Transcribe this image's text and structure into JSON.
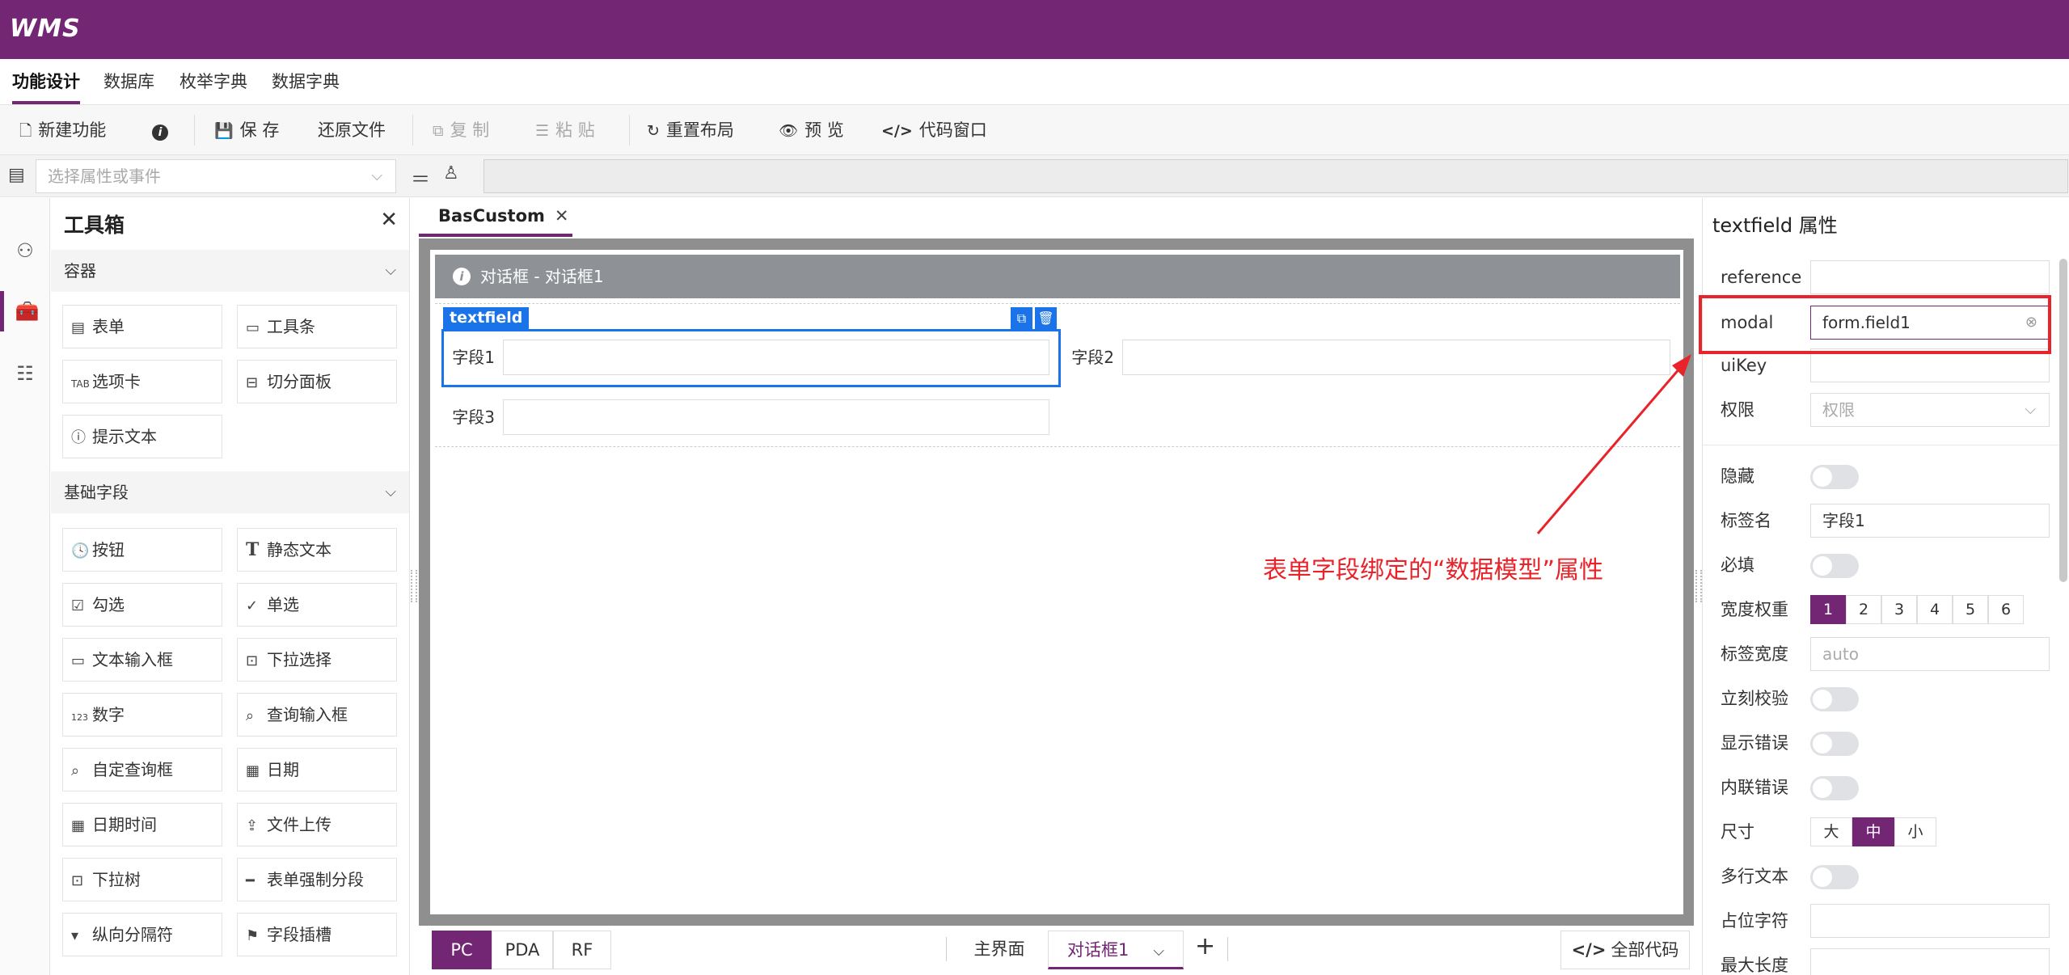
{
  "app": {
    "logo": "WMS"
  },
  "menu": {
    "items": [
      "功能设计",
      "数据库",
      "枚举字典",
      "数据字典"
    ]
  },
  "toolbar": {
    "new": "新建功能",
    "save": "保 存",
    "restore": "还原文件",
    "copy": "复 制",
    "paste": "粘 贴",
    "reset_layout": "重置布局",
    "preview": "预 览",
    "code_window": "代码窗口"
  },
  "selector": {
    "placeholder": "选择属性或事件"
  },
  "toolbox": {
    "title": "工具箱",
    "sections": [
      {
        "title": "容器",
        "items": [
          "表单",
          "工具条",
          "选项卡",
          "切分面板",
          "提示文本"
        ]
      },
      {
        "title": "基础字段",
        "items": [
          "按钮",
          "静态文本",
          "勾选",
          "单选",
          "文本输入框",
          "下拉选择",
          "数字",
          "查询输入框",
          "自定查询框",
          "日期",
          "日期时间",
          "文件上传",
          "下拉树",
          "表单强制分段",
          "纵向分隔符",
          "字段插槽"
        ]
      }
    ]
  },
  "designer": {
    "tab": "BasCustom",
    "dialog_title": "对话框 - 对话框1",
    "selected_tag": "textfield",
    "fields": [
      "字段1",
      "字段2",
      "字段3"
    ],
    "annotation": "表单字段绑定的“数据模型”属性"
  },
  "bottom": {
    "platforms": [
      "PC",
      "PDA",
      "RF"
    ],
    "views": [
      "主界面",
      "对话框1"
    ],
    "all_code": "全部代码"
  },
  "props": {
    "title": "textfield 属性",
    "reference_label": "reference",
    "modal_label": "modal",
    "modal_value": "form.field1",
    "uikey_label": "uiKey",
    "permission_label": "权限",
    "permission_placeholder": "权限",
    "hidden_label": "隐藏",
    "label_name_label": "标签名",
    "label_name_value": "字段1",
    "required_label": "必填",
    "width_weight_label": "宽度权重",
    "width_weights": [
      "1",
      "2",
      "3",
      "4",
      "5",
      "6"
    ],
    "label_width_label": "标签宽度",
    "label_width_placeholder": "auto",
    "instant_validate_label": "立刻校验",
    "show_error_label": "显示错误",
    "inline_error_label": "内联错误",
    "size_label": "尺寸",
    "sizes": [
      "大",
      "中",
      "小"
    ],
    "multiline_label": "多行文本",
    "placeholder_label": "占位字符",
    "maxlength_label": "最大长度"
  }
}
